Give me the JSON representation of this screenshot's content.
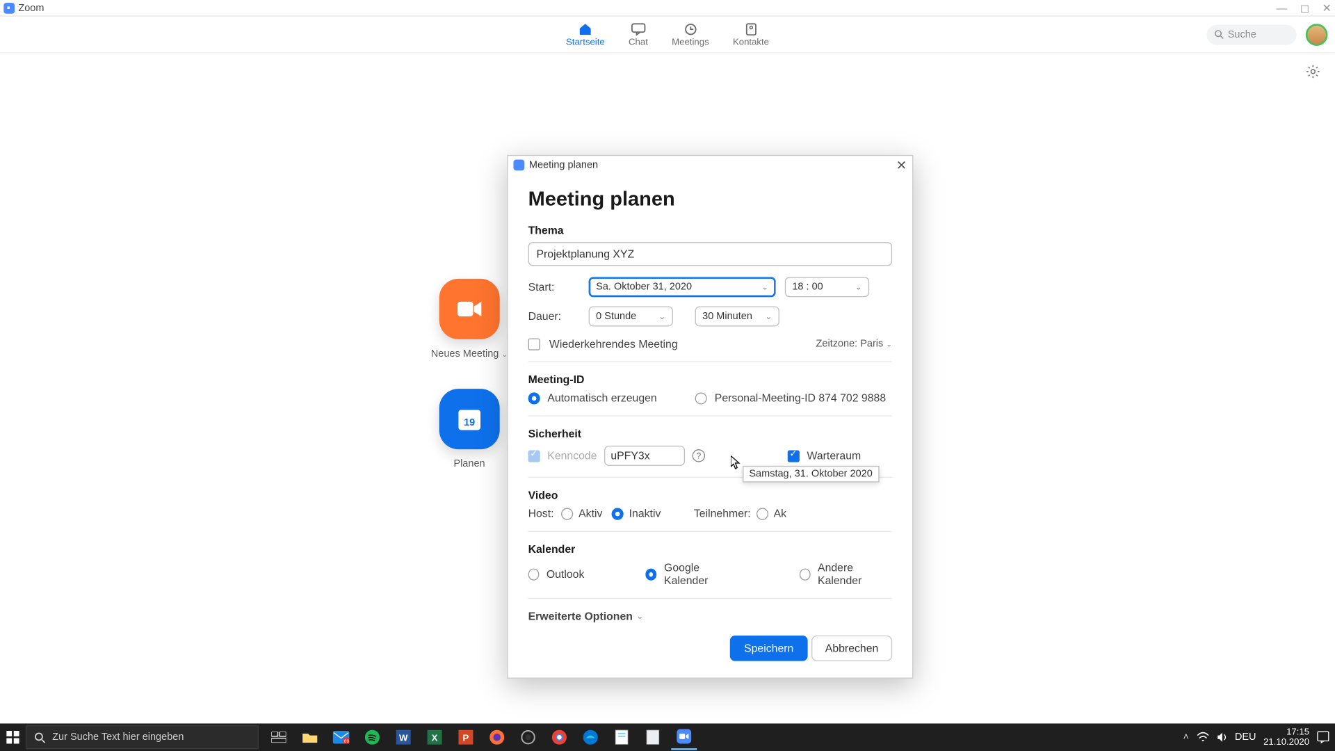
{
  "app": {
    "title": "Zoom"
  },
  "nav": {
    "home": "Startseite",
    "chat": "Chat",
    "meetings": "Meetings",
    "contacts": "Kontakte"
  },
  "search": {
    "placeholder": "Suche"
  },
  "home_actions": {
    "new_meeting": "Neues Meeting",
    "schedule": "Planen",
    "calendar_day": "19"
  },
  "dialog": {
    "window_title": "Meeting planen",
    "title": "Meeting planen",
    "topic_label": "Thema",
    "topic_value": "Projektplanung XYZ",
    "start_label": "Start:",
    "start_date": "Sa.  Oktober  31,  2020",
    "start_time": "18 : 00",
    "duration_label": "Dauer:",
    "duration_hours": "0 Stunde",
    "duration_minutes": "30 Minuten",
    "recurring_label": "Wiederkehrendes Meeting",
    "timezone": "Zeitzone: Paris",
    "meeting_id_label": "Meeting-ID",
    "mid_auto": "Automatisch erzeugen",
    "mid_personal": "Personal-Meeting-ID 874 702 9888",
    "security_label": "Sicherheit",
    "passcode_label": "Kenncode",
    "passcode_value": "uPFY3x",
    "waiting_room": "Warteraum",
    "video_label": "Video",
    "host_label": "Host:",
    "active": "Aktiv",
    "inactive": "Inaktiv",
    "participants_label": "Teilnehmer:",
    "participant_active_partial": "Ak",
    "calendar_label": "Kalender",
    "cal_outlook": "Outlook",
    "cal_google": "Google Kalender",
    "cal_other": "Andere Kalender",
    "advanced": "Erweiterte Optionen",
    "save": "Speichern",
    "cancel": "Abbrechen"
  },
  "tooltip": "Samstag, 31. Oktober 2020",
  "taskbar": {
    "search_placeholder": "Zur Suche Text hier eingeben",
    "lang": "DEU",
    "time": "17:15",
    "date": "21.10.2020"
  }
}
